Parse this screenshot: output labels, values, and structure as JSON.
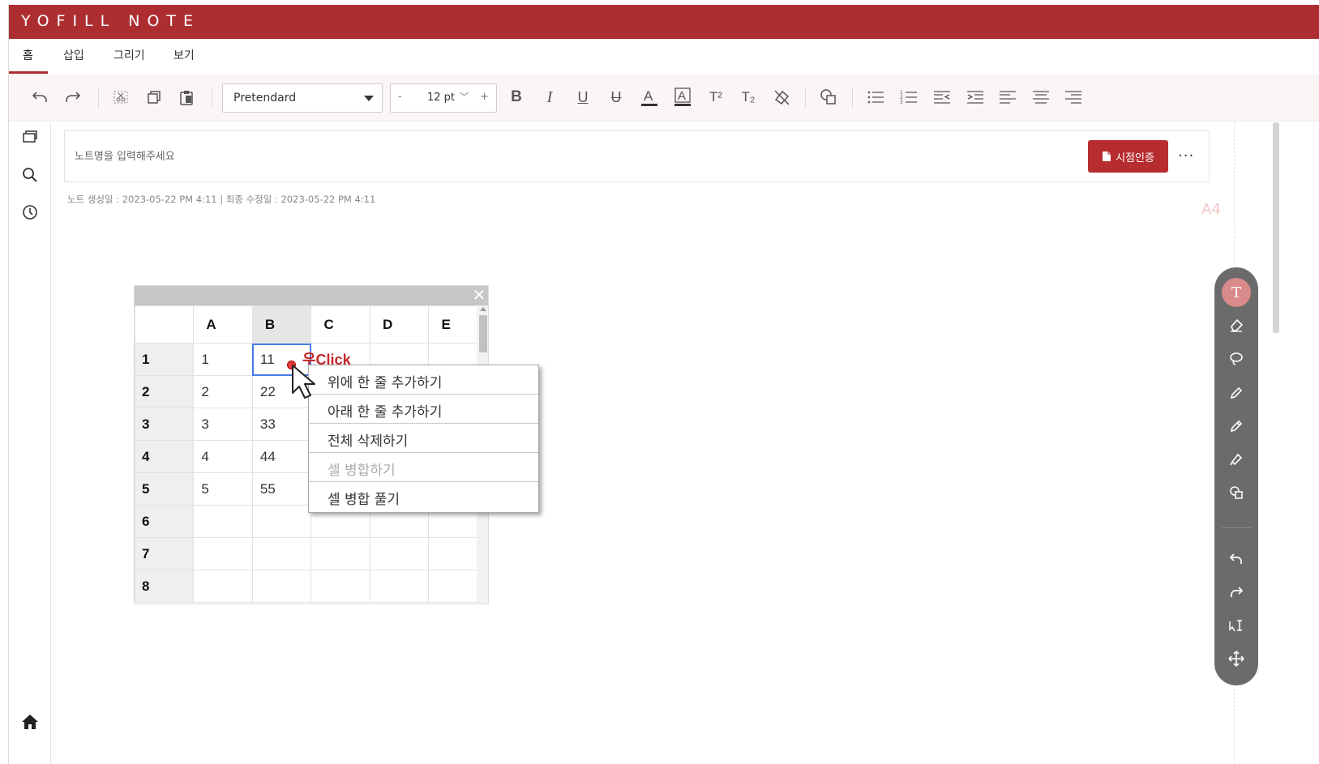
{
  "app": {
    "title": "YOFILL NOTE"
  },
  "tabs": [
    {
      "label": "홈",
      "active": true
    },
    {
      "label": "삽입",
      "active": false
    },
    {
      "label": "그리기",
      "active": false
    },
    {
      "label": "보기",
      "active": false
    }
  ],
  "toolbar": {
    "font_family": "Pretendard",
    "font_size": "12 pt",
    "size_minus": "-",
    "size_plus": "+",
    "icons": [
      "undo-icon",
      "redo-icon",
      "cut-icon",
      "copy-icon",
      "paste-icon",
      "bold-icon",
      "italic-icon",
      "underline-icon",
      "strikethrough-icon",
      "font-color-icon",
      "highlight-color-icon",
      "superscript-icon",
      "subscript-icon",
      "clear-format-icon",
      "shapes-icon",
      "bullet-list-icon",
      "numbered-list-icon",
      "outdent-icon",
      "indent-icon",
      "align-left-icon",
      "align-center-icon",
      "align-right-icon"
    ]
  },
  "sidebar": {
    "icons": [
      "pages-icon",
      "search-icon",
      "history-icon",
      "home-icon"
    ]
  },
  "note": {
    "placeholder": "노트명을 입력해주세요",
    "cert_button": "시점인증",
    "more": "···",
    "meta": "노트 생성일 : 2023-05-22 PM 4:11   |   최종 수정일 : 2023-05-22 PM 4:11",
    "page_size": "A4"
  },
  "spreadsheet": {
    "columns": [
      "A",
      "B",
      "C",
      "D",
      "E"
    ],
    "rows": [
      {
        "n": "1",
        "cells": [
          "1",
          "11",
          "",
          "",
          ""
        ]
      },
      {
        "n": "2",
        "cells": [
          "2",
          "22",
          "",
          "",
          ""
        ]
      },
      {
        "n": "3",
        "cells": [
          "3",
          "33",
          "",
          "",
          ""
        ]
      },
      {
        "n": "4",
        "cells": [
          "4",
          "44",
          "",
          "",
          ""
        ]
      },
      {
        "n": "5",
        "cells": [
          "5",
          "55",
          "",
          "",
          ""
        ]
      },
      {
        "n": "6",
        "cells": [
          "",
          "",
          "",
          "",
          ""
        ]
      },
      {
        "n": "7",
        "cells": [
          "",
          "",
          "",
          "",
          ""
        ]
      },
      {
        "n": "8",
        "cells": [
          "",
          "",
          "",
          "",
          ""
        ]
      }
    ],
    "close": "✕"
  },
  "context_menu": {
    "items": [
      {
        "label": "위에 한 줄 추가하기",
        "enabled": true
      },
      {
        "label": "아래 한 줄 추가하기",
        "enabled": true
      },
      {
        "label": "전체 삭제하기",
        "enabled": true
      },
      {
        "label": "셀 병합하기",
        "enabled": false
      },
      {
        "label": "셀 병합 풀기",
        "enabled": true
      }
    ]
  },
  "annotation": "우Click",
  "right_panel": {
    "active_tool": "T",
    "tools": [
      "text-tool-icon",
      "eraser-icon",
      "lasso-icon",
      "pen-icon",
      "pencil-icon",
      "highlighter-icon",
      "shape-icon",
      "undo-icon",
      "redo-icon",
      "text-select-icon",
      "move-icon"
    ]
  },
  "colors": {
    "brand": "#ad2e31",
    "cert_button": "#b72c2f",
    "panel": "#6b6b6b",
    "selection": "#4a7be0"
  }
}
